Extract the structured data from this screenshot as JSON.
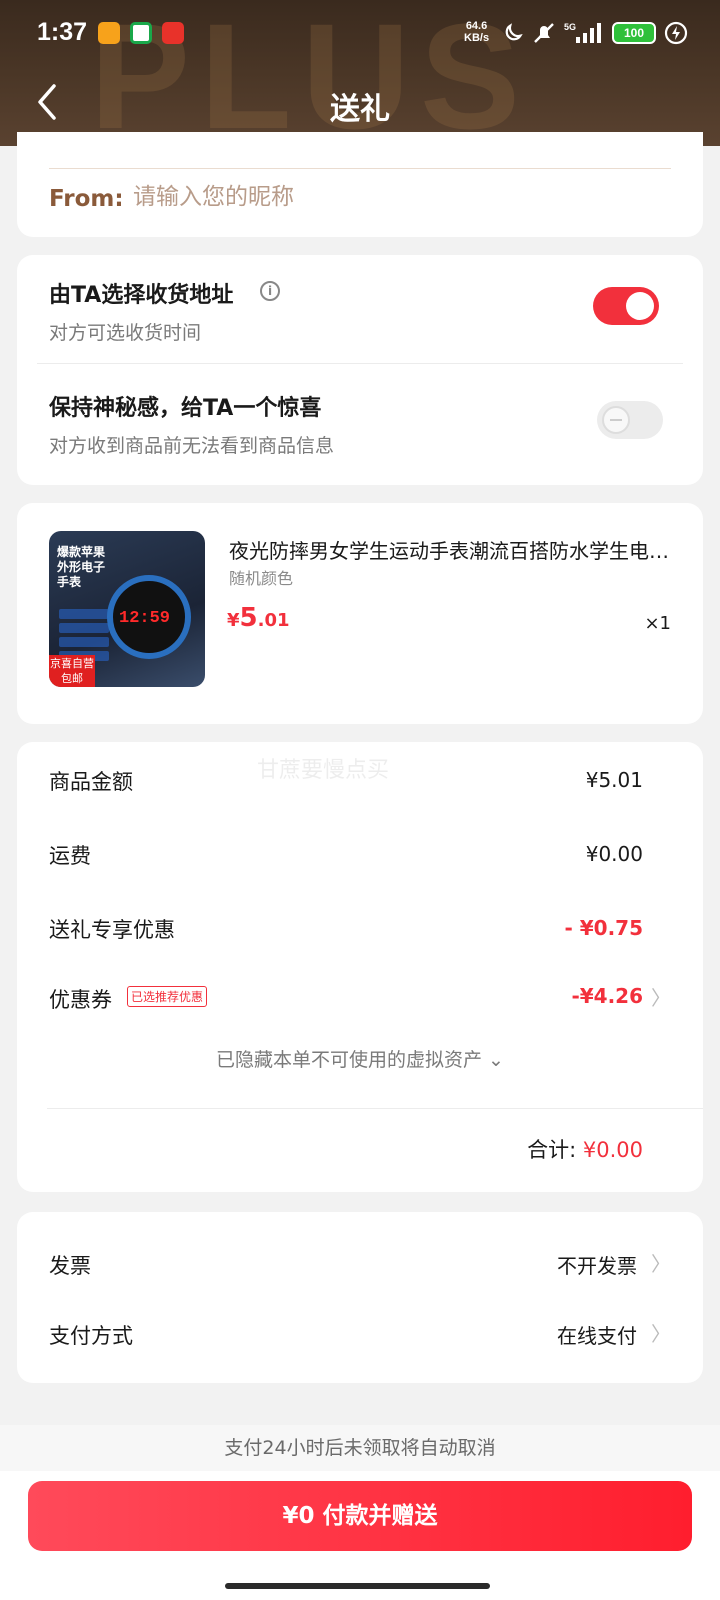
{
  "status_bar": {
    "time": "1:37",
    "net_speed_value": "64.6",
    "net_speed_unit": "KB/s",
    "signal": "5G",
    "battery": "100"
  },
  "nav": {
    "title": "送礼"
  },
  "sender": {
    "label": "From:",
    "placeholder": "请输入您的昵称",
    "value": ""
  },
  "options": {
    "address_title": "由TA选择收货地址",
    "address_sub": "对方可选收货时间",
    "address_on": true,
    "mystery_title": "保持神秘感，给TA一个惊喜",
    "mystery_sub": "对方收到商品前无法看到商品信息",
    "mystery_on": false
  },
  "product": {
    "title": "夜光防摔男女学生运动手表潮流百搭防水学生电子表",
    "sku": "随机颜色",
    "price_symbol": "¥",
    "price_int": "5",
    "price_dec": ".01",
    "qty": "×1",
    "image_text": {
      "headline": "爆款苹果外形电子手表",
      "digits": "12:59",
      "badge": "京喜自营包邮"
    }
  },
  "summary": {
    "watermark": "甘蔗要慢点买",
    "goods_label": "商品金额",
    "goods_value": "¥5.01",
    "shipping_label": "运费",
    "shipping_value": "¥0.00",
    "gift_label": "送礼专享优惠",
    "gift_value": "- ¥0.75",
    "coupon_label": "优惠券",
    "coupon_tag": "已选推荐优惠",
    "coupon_value": "-¥4.26",
    "hidden_assets": "已隐藏本单不可使用的虚拟资产 ⌄",
    "total_label": "合计:",
    "total_value": "¥0.00"
  },
  "settings": {
    "invoice_label": "发票",
    "invoice_value": "不开发票",
    "payment_label": "支付方式",
    "payment_value": "在线支付"
  },
  "footer": {
    "notice": "支付24小时后未领取将自动取消",
    "pay_button": "¥0 付款并赠送"
  },
  "colors": {
    "accent": "#f2303c",
    "header": "#4a3626"
  }
}
